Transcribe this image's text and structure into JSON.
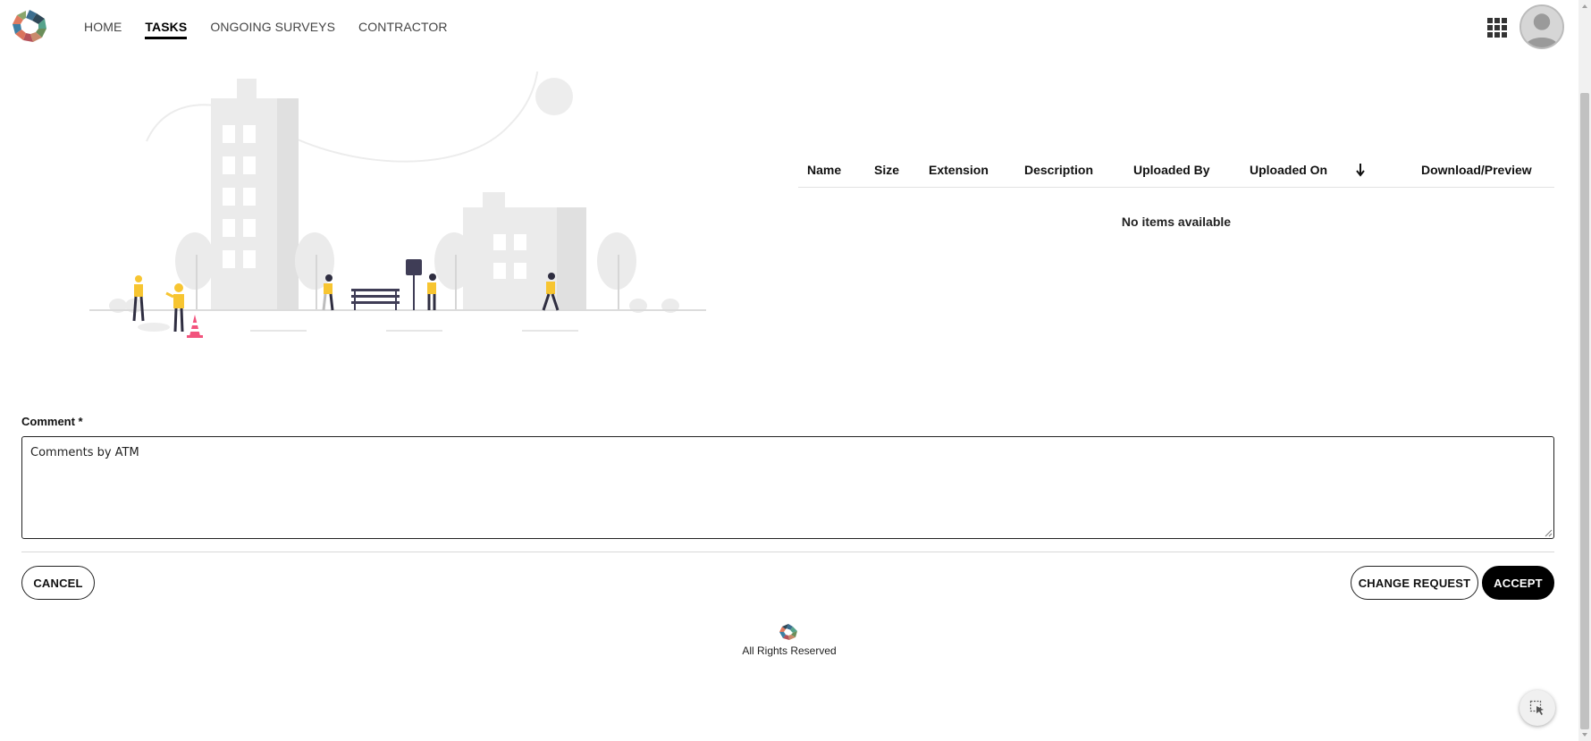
{
  "nav": {
    "items": [
      {
        "label": "HOME",
        "active": false
      },
      {
        "label": "TASKS",
        "active": true
      },
      {
        "label": "ONGOING SURVEYS",
        "active": false
      },
      {
        "label": "CONTRACTOR",
        "active": false
      }
    ]
  },
  "header": {
    "apps_icon": "grid-apps-icon",
    "avatar_icon": "user-avatar-icon"
  },
  "files": {
    "columns": [
      "Name",
      "Size",
      "Extension",
      "Description",
      "Uploaded By",
      "Uploaded On",
      "Download/Preview"
    ],
    "sort_icon": "arrow-down-icon",
    "empty_message": "No items available"
  },
  "comment": {
    "label": "Comment *",
    "value": "Comments by ATM"
  },
  "actions": {
    "cancel": "CANCEL",
    "change_request": "CHANGE REQUEST",
    "accept": "ACCEPT"
  },
  "footer": {
    "text": "All Rights Reserved"
  },
  "colors": {
    "accent": "#000000",
    "illustration_yellow": "#f7c531",
    "illustration_pink": "#f2547d",
    "illustration_gray": "#ebebeb"
  }
}
